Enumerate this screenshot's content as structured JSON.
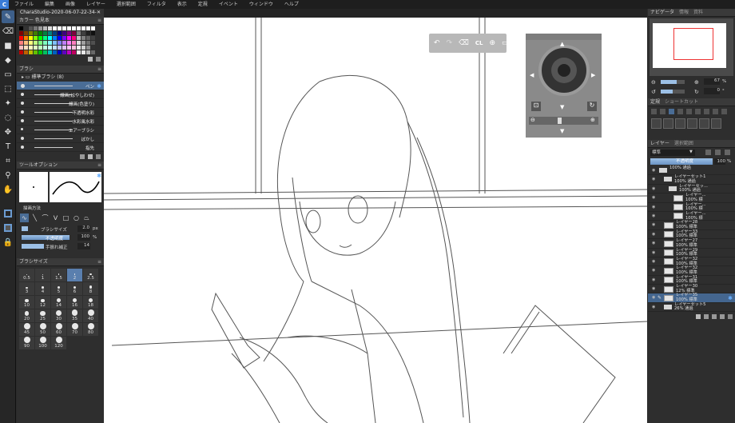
{
  "app": {
    "menu": [
      "ファイル",
      "編集",
      "画像",
      "レイヤー",
      "選択範囲",
      "フィルタ",
      "表示",
      "定規",
      "イベント",
      "ウィンドウ",
      "ヘルプ"
    ],
    "document_tab": "CharaStudio-2020-06-07-22-34-2...",
    "close_label": "✕"
  },
  "left": {
    "color_panel_title": "カラー  色見本",
    "swatch_colors": [
      "#000000",
      "#333333",
      "#555555",
      "#777777",
      "#999999",
      "#bbbbbb",
      "#dddddd",
      "#ffffff",
      "#ffffff",
      "#ffffff",
      "#ffffff",
      "#ffffff",
      "#ffffff",
      "#ffffff",
      "#ffffff",
      "#ffffff",
      "#7f0000",
      "#7f3f00",
      "#7f7f00",
      "#3f7f00",
      "#007f00",
      "#007f3f",
      "#007f7f",
      "#003f7f",
      "#00007f",
      "#3f007f",
      "#7f007f",
      "#7f003f",
      "#7f7f7f",
      "#3f3f3f",
      "#202020",
      "#101010",
      "#ff0000",
      "#ff7f00",
      "#ffff00",
      "#7fff00",
      "#00ff00",
      "#00ff7f",
      "#00ffff",
      "#007fff",
      "#0000ff",
      "#7f00ff",
      "#ff00ff",
      "#ff007f",
      "#c0c0c0",
      "#808080",
      "#606060",
      "#404040",
      "#ff7f7f",
      "#ffbf7f",
      "#ffff7f",
      "#bfff7f",
      "#7fff7f",
      "#7fffbf",
      "#7fffff",
      "#7fbfff",
      "#7f7fff",
      "#bf7fff",
      "#ff7fff",
      "#ff7fbf",
      "#e0e0e0",
      "#a0a0a0",
      "#707070",
      "#505050",
      "#ffbfbf",
      "#ffdfbf",
      "#ffffbf",
      "#dfffbf",
      "#bfffbf",
      "#bfffdf",
      "#bfffff",
      "#bfdfff",
      "#bfbfff",
      "#dfbfff",
      "#ffbfff",
      "#ffbfdf",
      "#f0f0f0",
      "#d0d0d0",
      "#909090",
      "#303030",
      "#c00000",
      "#c06000",
      "#c0c000",
      "#60c000",
      "#00c000",
      "#00c060",
      "#00c0c0",
      "#0060c0",
      "#0000c0",
      "#6000c0",
      "#c000c0",
      "#c00060",
      "#f8f8f8",
      "#e8e8e8",
      "#b8b8b8",
      "#686868"
    ],
    "brush_panel_title": "ブラシ",
    "brush_category": "標準ブラシ (8)",
    "brushes": [
      {
        "label": "ペン",
        "selected": true
      },
      {
        "label": "線画(はやしわせ)",
        "selected": false
      },
      {
        "label": "線画(色塗り)",
        "selected": false
      },
      {
        "label": "不透明水彩",
        "selected": false
      },
      {
        "label": "水彩風水彩",
        "selected": false
      },
      {
        "label": "エアーブラシ",
        "selected": false
      },
      {
        "label": "ぼかし",
        "selected": false
      },
      {
        "label": "指先",
        "selected": false
      }
    ],
    "tool_options_title": "ツールオプション",
    "draw_method_label": "描画方法",
    "brush_size_label": "ブラシサイズ",
    "brush_size_value": "2.0",
    "brush_size_unit": "px",
    "opacity_label": "不透明度",
    "opacity_value": "100",
    "opacity_unit": "%",
    "stabilizer_label": "手振れ補正",
    "stabilizer_value": "14",
    "brush_size_panel_title": "ブラシサイズ",
    "sizes": [
      "0.5",
      "1",
      "1.5",
      "2",
      "2.5",
      "3",
      "4",
      "5",
      "6",
      "8",
      "10",
      "12",
      "14",
      "16",
      "18",
      "20",
      "25",
      "30",
      "35",
      "40",
      "45",
      "50",
      "60",
      "70",
      "80",
      "90",
      "100",
      "120"
    ],
    "selected_size": "2"
  },
  "right": {
    "nav_tabs": [
      "ナビゲータ",
      "情報",
      "資料"
    ],
    "zoom_value": "67",
    "zoom_unit": "%",
    "rotation_value": "0",
    "rotation_unit": "°",
    "shortcut_tabs": [
      "定規",
      "ショートカット"
    ],
    "layer_tabs": [
      "レイヤー",
      "選択範囲"
    ],
    "blend_mode": "標準",
    "opacity_label": "不透明度",
    "opacity_value": "100",
    "opacity_unit": "%",
    "layers": [
      {
        "name": "100% 通過",
        "line2": "",
        "indent": 0,
        "folder": true,
        "selected": false
      },
      {
        "name": "レイヤーセット1",
        "line2": "100% 通過",
        "indent": 1,
        "folder": true,
        "selected": false
      },
      {
        "name": "レイヤーセッ...",
        "line2": "100% 通過",
        "indent": 2,
        "folder": true,
        "selected": false
      },
      {
        "name": "レイヤー...",
        "line2": "100% 標",
        "indent": 3,
        "folder": false,
        "selected": false
      },
      {
        "name": "レイヤー...",
        "line2": "100% 標",
        "indent": 3,
        "folder": false,
        "selected": false
      },
      {
        "name": "レイヤー...",
        "line2": "100% 標",
        "indent": 3,
        "folder": false,
        "selected": false
      },
      {
        "name": "レイヤー28",
        "line2": "100% 標準",
        "indent": 1,
        "folder": false,
        "selected": false
      },
      {
        "name": "レイヤー33",
        "line2": "100% 標準",
        "indent": 1,
        "folder": false,
        "selected": false
      },
      {
        "name": "レイヤー27",
        "line2": "100% 標準",
        "indent": 1,
        "folder": false,
        "selected": false
      },
      {
        "name": "レイヤー29",
        "line2": "100% 標準",
        "indent": 1,
        "folder": false,
        "selected": false
      },
      {
        "name": "レイヤー32",
        "line2": "100% 標準",
        "indent": 1,
        "folder": false,
        "selected": false
      },
      {
        "name": "レイヤー32",
        "line2": "100% 標準",
        "indent": 1,
        "folder": false,
        "selected": false
      },
      {
        "name": "レイヤー31",
        "line2": "100% 標準",
        "indent": 1,
        "folder": false,
        "selected": false
      },
      {
        "name": "レイヤー30",
        "line2": "12% 標準",
        "indent": 1,
        "folder": false,
        "selected": false
      },
      {
        "name": "レイヤー35",
        "line2": "100% 標準",
        "indent": 1,
        "folder": false,
        "selected": true
      },
      {
        "name": "レイヤーセット5",
        "line2": "26% 通過",
        "indent": 1,
        "folder": true,
        "selected": false
      }
    ]
  },
  "canvas_toolbar": {
    "clear_label": "CL"
  }
}
